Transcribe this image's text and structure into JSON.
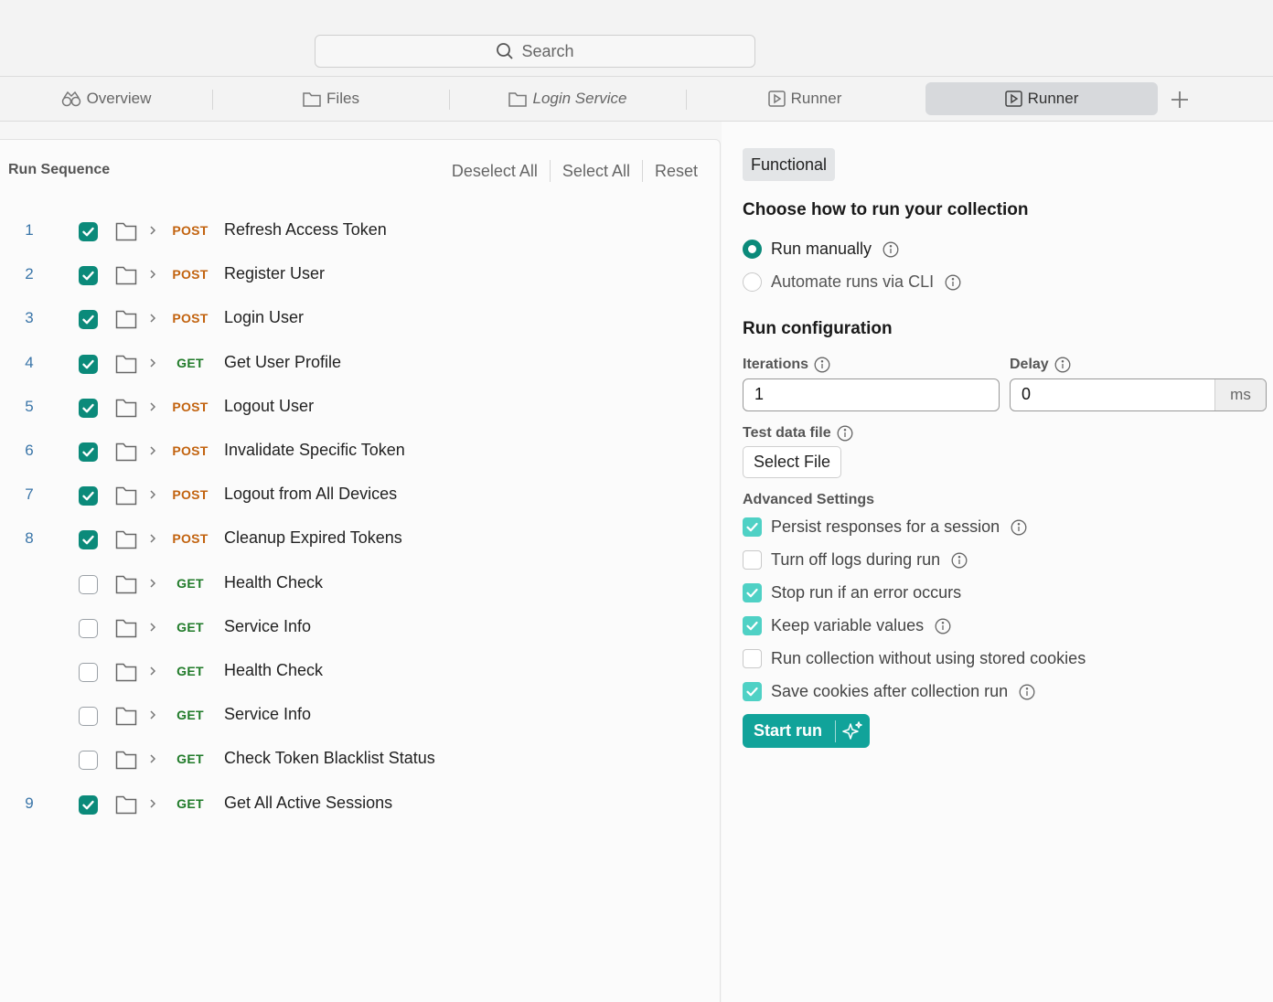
{
  "search": {
    "placeholder": "Search"
  },
  "tabs": [
    {
      "label": "Overview",
      "icon": "overview-icon"
    },
    {
      "label": "Files",
      "icon": "folder-icon"
    },
    {
      "label": "Login Service",
      "icon": "folder-icon"
    },
    {
      "label": "Runner",
      "icon": "runner-icon"
    },
    {
      "label": "Runner",
      "icon": "runner-icon",
      "active": true
    }
  ],
  "sequence": {
    "title": "Run Sequence",
    "actions": {
      "deselect_all": "Deselect All",
      "select_all": "Select All",
      "reset": "Reset"
    },
    "rows": [
      {
        "num": "1",
        "checked": true,
        "method": "POST",
        "name": "Refresh Access Token"
      },
      {
        "num": "2",
        "checked": true,
        "method": "POST",
        "name": "Register User"
      },
      {
        "num": "3",
        "checked": true,
        "method": "POST",
        "name": "Login User"
      },
      {
        "num": "4",
        "checked": true,
        "method": "GET",
        "name": "Get User Profile"
      },
      {
        "num": "5",
        "checked": true,
        "method": "POST",
        "name": "Logout User"
      },
      {
        "num": "6",
        "checked": true,
        "method": "POST",
        "name": "Invalidate Specific Token"
      },
      {
        "num": "7",
        "checked": true,
        "method": "POST",
        "name": "Logout from All Devices"
      },
      {
        "num": "8",
        "checked": true,
        "method": "POST",
        "name": "Cleanup Expired Tokens"
      },
      {
        "num": "",
        "checked": false,
        "method": "GET",
        "name": "Health Check"
      },
      {
        "num": "",
        "checked": false,
        "method": "GET",
        "name": "Service Info"
      },
      {
        "num": "",
        "checked": false,
        "method": "GET",
        "name": "Health Check"
      },
      {
        "num": "",
        "checked": false,
        "method": "GET",
        "name": "Service Info"
      },
      {
        "num": "",
        "checked": false,
        "method": "GET",
        "name": "Check Token Blacklist Status"
      },
      {
        "num": "9",
        "checked": true,
        "method": "GET",
        "name": "Get All Active Sessions"
      }
    ]
  },
  "config": {
    "badge": "Functional",
    "choose_title": "Choose how to run your collection",
    "run_modes": [
      {
        "label": "Run manually",
        "selected": true
      },
      {
        "label": "Automate runs via CLI",
        "selected": false
      }
    ],
    "run_config_title": "Run configuration",
    "iterations": {
      "label": "Iterations",
      "value": "1"
    },
    "delay": {
      "label": "Delay",
      "value": "0",
      "unit": "ms"
    },
    "test_data": {
      "label": "Test data file",
      "button": "Select File"
    },
    "advanced": {
      "title": "Advanced Settings",
      "options": [
        {
          "label": "Persist responses for a session",
          "checked": true,
          "info": true
        },
        {
          "label": "Turn off logs during run",
          "checked": false,
          "info": true
        },
        {
          "label": "Stop run if an error occurs",
          "checked": true,
          "info": false
        },
        {
          "label": "Keep variable values",
          "checked": true,
          "info": true
        },
        {
          "label": "Run collection without using stored cookies",
          "checked": false,
          "info": false
        },
        {
          "label": "Save cookies after collection run",
          "checked": true,
          "info": true
        }
      ]
    },
    "start_button": "Start run"
  },
  "colors": {
    "accent": "#0b8a7a",
    "post": "#c2630f",
    "get": "#1f7a28",
    "start": "#11a39a"
  }
}
